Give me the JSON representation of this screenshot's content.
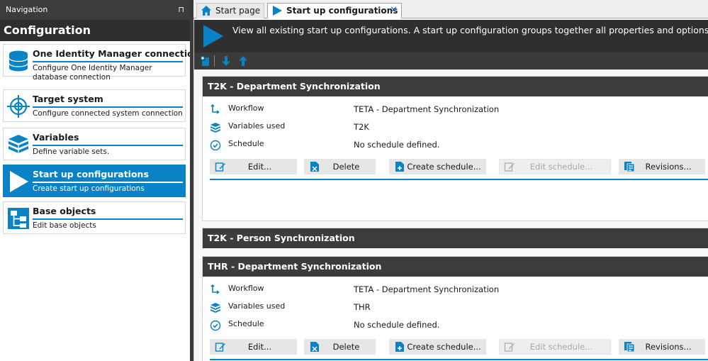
{
  "nav": {
    "header": "Navigation",
    "pin_glyph": "⊓",
    "section_title": "Configuration",
    "items": [
      {
        "title": "One Identity Manager connection",
        "desc": "Configure One Identity Manager database connection",
        "icon": "database-icon",
        "active": false
      },
      {
        "title": "Target system",
        "desc": "Configure connected system connection",
        "icon": "crosshair-icon",
        "active": false
      },
      {
        "title": "Variables",
        "desc": "Define variable sets.",
        "icon": "cube-stack-icon",
        "active": false
      },
      {
        "title": "Start up configurations",
        "desc": "Create start up configurations",
        "icon": "play-icon",
        "active": true
      },
      {
        "title": "Base objects",
        "desc": "Edit base objects",
        "icon": "hierarchy-icon",
        "active": false
      }
    ]
  },
  "tabs": [
    {
      "label": "Start page",
      "icon": "home-icon",
      "active": false
    },
    {
      "label": "Start up configurations",
      "icon": "play-icon",
      "active": true,
      "close_glyph": "✕"
    }
  ],
  "banner": {
    "text": "View all existing start up configurations. A start up configuration groups together all properties and options re"
  },
  "toolbar": {
    "buttons": [
      "new-config-icon",
      "move-down-icon",
      "move-up-icon"
    ]
  },
  "cards": [
    {
      "title": "T2K - Department Synchronization",
      "expanded": true,
      "props": [
        {
          "label": "Workflow",
          "value": "TETA - Department Synchronization",
          "icon": "workflow-icon"
        },
        {
          "label": "Variables used",
          "value": "T2K",
          "icon": "variables-icon"
        },
        {
          "label": "Schedule",
          "value": "No schedule defined.",
          "icon": "schedule-check-icon"
        }
      ],
      "buttons": [
        {
          "label": "Edit...",
          "icon": "edit-icon",
          "enabled": true
        },
        {
          "label": "Delete",
          "icon": "delete-icon",
          "enabled": true
        },
        {
          "label": "Create schedule...",
          "icon": "add-schedule-icon",
          "enabled": true
        },
        {
          "label": "Edit schedule...",
          "icon": "edit-schedule-icon",
          "enabled": false
        },
        {
          "label": "Revisions...",
          "icon": "revisions-icon",
          "enabled": true
        }
      ]
    },
    {
      "title": "T2K - Person Synchronization",
      "expanded": false
    },
    {
      "title": "THR - Department Synchronization",
      "expanded": true,
      "props": [
        {
          "label": "Workflow",
          "value": "TETA - Department Synchronization",
          "icon": "workflow-icon"
        },
        {
          "label": "Variables used",
          "value": "THR",
          "icon": "variables-icon"
        },
        {
          "label": "Schedule",
          "value": "No schedule defined.",
          "icon": "schedule-check-icon"
        }
      ],
      "buttons": [
        {
          "label": "Edit...",
          "icon": "edit-icon",
          "enabled": true
        },
        {
          "label": "Delete",
          "icon": "delete-icon",
          "enabled": true
        },
        {
          "label": "Create schedule...",
          "icon": "add-schedule-icon",
          "enabled": true
        },
        {
          "label": "Edit schedule...",
          "icon": "edit-schedule-icon",
          "enabled": false
        },
        {
          "label": "Revisions...",
          "icon": "revisions-icon",
          "enabled": true
        }
      ]
    }
  ],
  "colors": {
    "accent": "#0a83c6",
    "dark_header": "#3c3c3c",
    "banner": "#2f2f2f"
  }
}
